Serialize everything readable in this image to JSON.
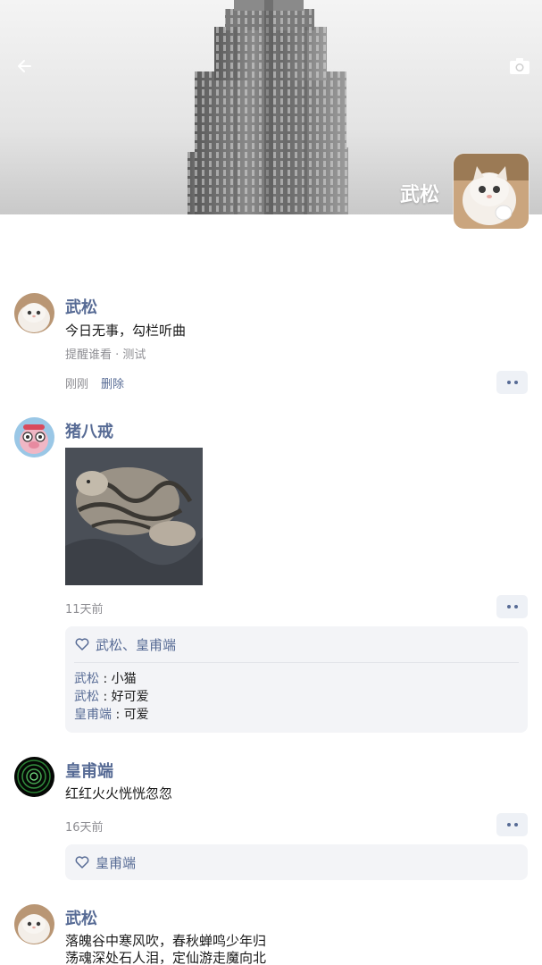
{
  "header": {
    "back_icon": "arrow-left-icon",
    "camera_icon": "camera-icon",
    "profile_name": "武松"
  },
  "posts": [
    {
      "author": "武松",
      "text": "今日无事，勾栏听曲",
      "visibility": "提醒谁看 · 测试",
      "time": "刚刚",
      "delete_label": "删除"
    },
    {
      "author": "猪八戒",
      "time": "11天前",
      "likes": "武松、皇甫端",
      "comments": [
        {
          "name": "武松",
          "sep": " : ",
          "text": "小猫"
        },
        {
          "name": "武松",
          "sep": " : ",
          "text": "好可爱"
        },
        {
          "name": "皇甫端",
          "sep": " : ",
          "text": "可爱"
        }
      ]
    },
    {
      "author": "皇甫端",
      "text": "红红火火恍恍忽忽",
      "time": "16天前",
      "likes": "皇甫端"
    },
    {
      "author": "武松",
      "lines": [
        "落魄谷中寒风吹，春秋蝉鸣少年归",
        "荡魂深处石人泪，定仙游走魔向北"
      ]
    }
  ],
  "colors": {
    "link": "#576b95",
    "panel": "#f3f4f7",
    "meta": "#8e8e93"
  }
}
